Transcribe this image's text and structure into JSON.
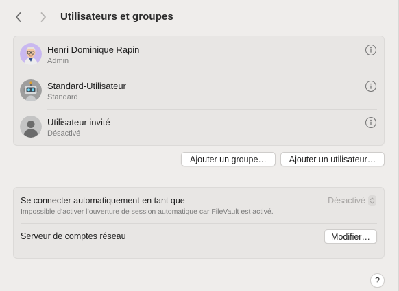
{
  "header": {
    "title": "Utilisateurs et groupes",
    "back_icon": "chevron-left-icon",
    "forward_icon": "chevron-right-icon"
  },
  "users": [
    {
      "name": "Henri Dominique Rapin",
      "role": "Admin",
      "avatar": "memoji-avatar"
    },
    {
      "name": "Standard-Utilisateur",
      "role": "Standard",
      "avatar": "robot-avatar"
    },
    {
      "name": "Utilisateur invité",
      "role": "Désactivé",
      "avatar": "generic-person-avatar"
    }
  ],
  "actions": {
    "add_group_label": "Ajouter un groupe…",
    "add_user_label": "Ajouter un utilisateur…"
  },
  "auto_login": {
    "title": "Se connecter automatiquement en tant que",
    "description": "Impossible d’activer l’ouverture de session automatique car FileVault est activé.",
    "selected_value": "Désactivé"
  },
  "network_server": {
    "label": "Serveur de comptes réseau",
    "button_label": "Modifier…"
  },
  "help": {
    "label": "?"
  },
  "colors": {
    "background": "#efedeb",
    "group_background": "#e8e6e4",
    "disabled_text": "#a9a7a5",
    "secondary_text": "#808080"
  }
}
